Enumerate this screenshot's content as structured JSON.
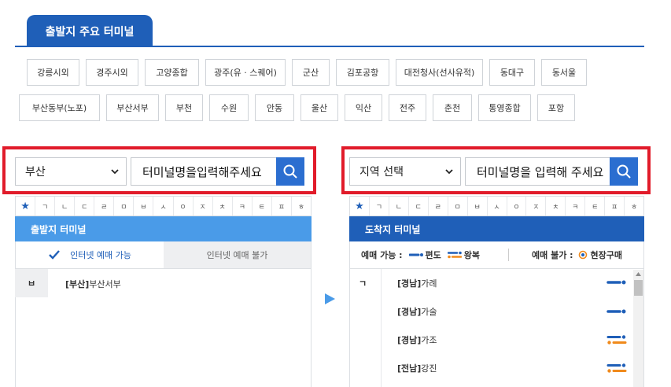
{
  "tab": {
    "label": "출발지 주요 터미널"
  },
  "terminals_row1": [
    "강릉시외",
    "경주시외",
    "고양종합",
    "광주(유 · 스퀘어)",
    "군산",
    "김포공항",
    "대전청사(선사유적)",
    "동대구",
    "동서울"
  ],
  "terminals_row2": [
    "부산동부(노포)",
    "부산서부",
    "부천",
    "수원",
    "안동",
    "울산",
    "익산",
    "전주",
    "춘천",
    "통영종합",
    "포항"
  ],
  "departure": {
    "region": "부산",
    "input_placeholder": "터미널명을입력해주세요",
    "panel_title": "출발지 터미널",
    "tab_available": "인터넷 예매 가능",
    "tab_unavailable": "인터넷 예매 불가",
    "group_letter": "ㅂ",
    "result_region": "[부산]",
    "result_name": "부산서부"
  },
  "arrival": {
    "region": "지역 선택",
    "input_placeholder": "터미널명을 입력해 주세요",
    "panel_title": "도착지 터미널",
    "legend_available": "예매 가능 :",
    "legend_oneway": "편도",
    "legend_roundtrip": "왕복",
    "legend_unavailable": "예매 불가 :",
    "legend_onsite": "현장구매",
    "group_letter": "ㄱ",
    "results": [
      {
        "region": "[경남]",
        "name": "가례",
        "type": "oneway"
      },
      {
        "region": "[경남]",
        "name": "가술",
        "type": "oneway"
      },
      {
        "region": "[경남]",
        "name": "가조",
        "type": "roundtrip"
      },
      {
        "region": "[전남]",
        "name": "강진",
        "type": "roundtrip"
      }
    ]
  },
  "alphabet": [
    "ㄱ",
    "ㄴ",
    "ㄷ",
    "ㄹ",
    "ㅁ",
    "ㅂ",
    "ㅅ",
    "ㅇ",
    "ㅈ",
    "ㅊ",
    "ㅋ",
    "ㅌ",
    "ㅍ",
    "ㅎ"
  ],
  "colors": {
    "primary": "#1f5fb8",
    "panel_head": "#4a9be8",
    "accent_red": "#e11b2a",
    "orange": "#f08a1c"
  }
}
